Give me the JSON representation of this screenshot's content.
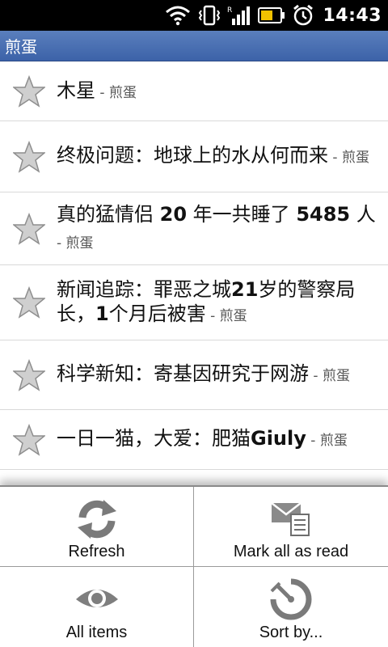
{
  "status": {
    "time": "14:43",
    "icons": [
      "wifi-icon",
      "vibrate-icon",
      "signal-icon",
      "battery-icon",
      "alarm-icon"
    ]
  },
  "app": {
    "title": "煎蛋"
  },
  "feed": {
    "items": [
      {
        "title": "木星",
        "source": "煎蛋"
      },
      {
        "title_parts": [
          "终极问题：地球上的水从何而来"
        ],
        "source": "煎蛋"
      },
      {
        "title_a": "真的猛情侣 ",
        "title_b": "20",
        "title_c": " 年一共睡了 ",
        "title_d": "5485",
        "title_e": " 人",
        "source": "煎蛋"
      },
      {
        "title_a": "新闻追踪：罪恶之城",
        "title_b": "21",
        "title_c": "岁的警察局长，",
        "title_d": "1",
        "title_e": "个月后被害",
        "source": "煎蛋"
      },
      {
        "title": "科学新知：寄基因研究于网游",
        "source": "煎蛋"
      },
      {
        "title_a": "一日一猫，大爱：肥猫",
        "title_b": "Giuly",
        "source": "煎蛋"
      }
    ],
    "separator": " - "
  },
  "menu": {
    "refresh": "Refresh",
    "mark_all_read": "Mark all as read",
    "all_items": "All items",
    "sort_by": "Sort by..."
  },
  "colors": {
    "titlebar": "#4a6fb2",
    "star": "#c8c8c8"
  }
}
